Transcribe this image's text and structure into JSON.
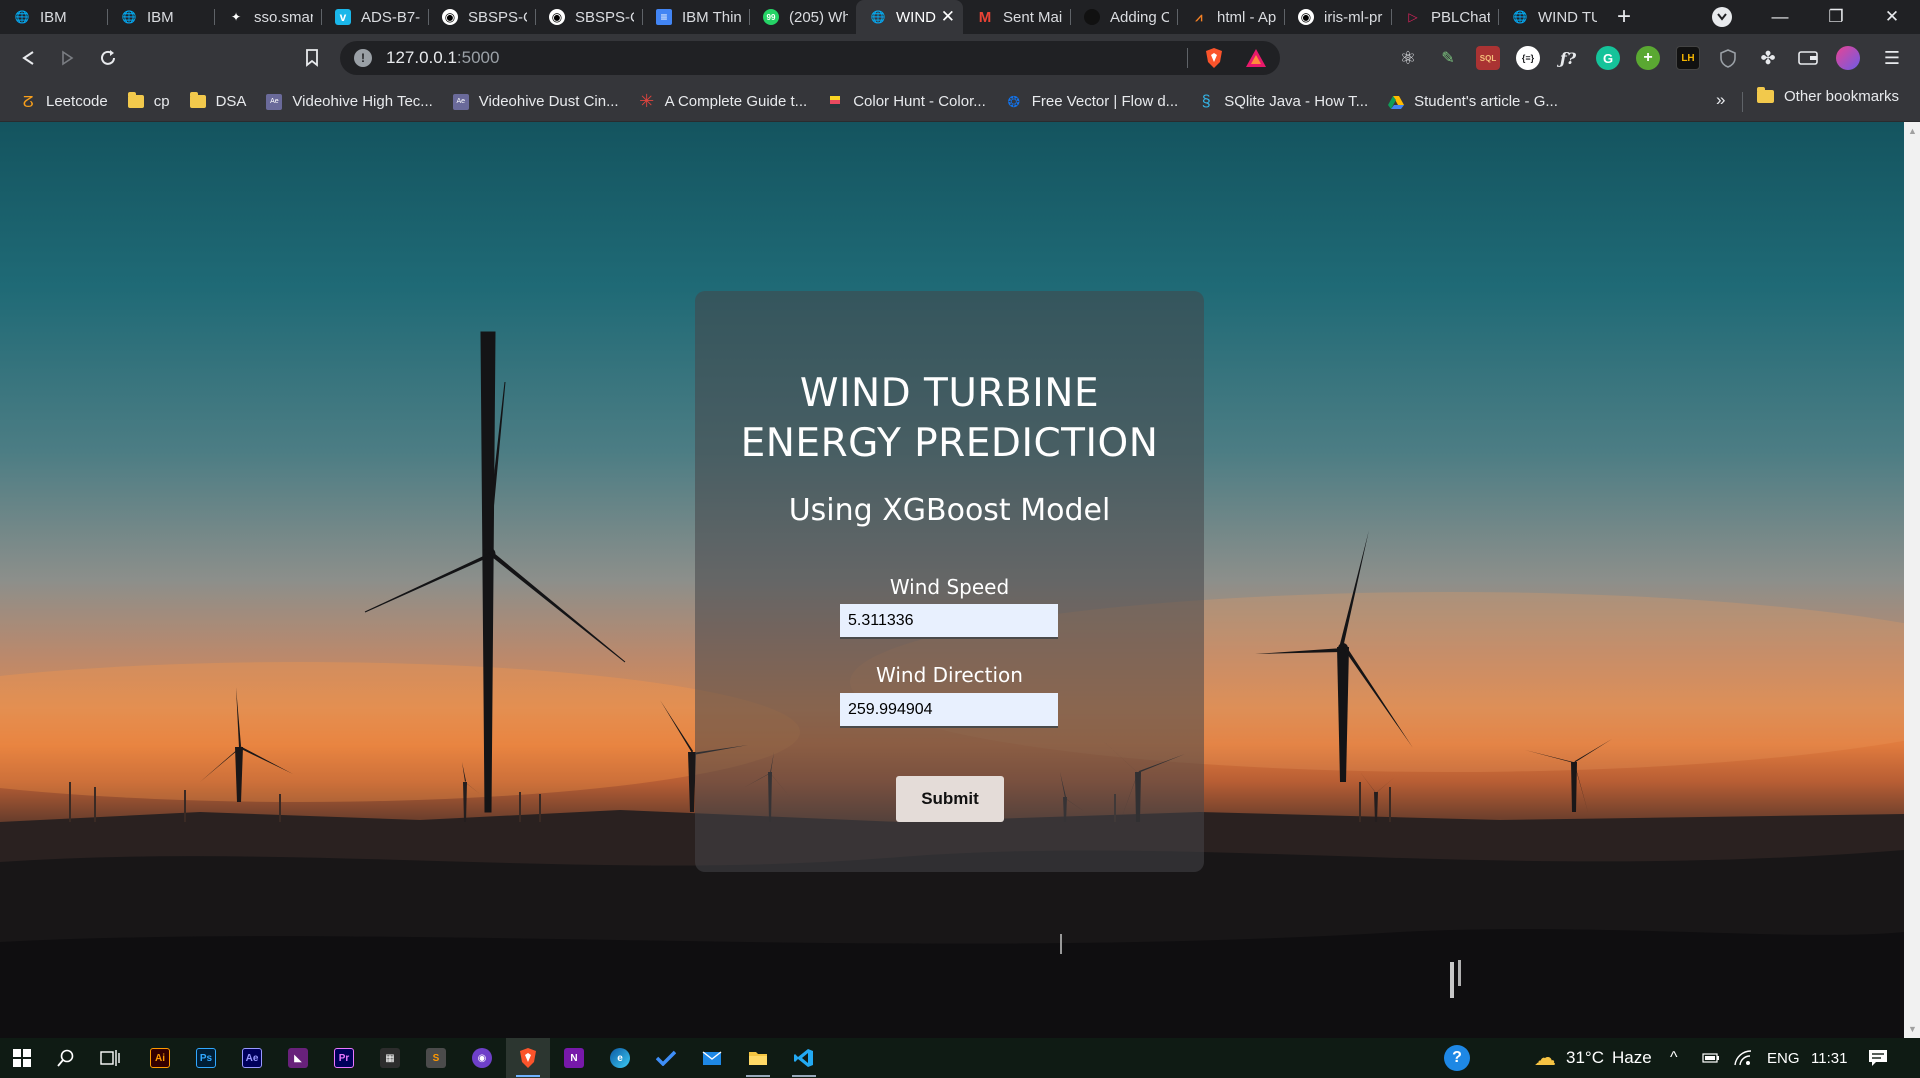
{
  "tabs": [
    {
      "title": "IBM",
      "icon": "globe-icon"
    },
    {
      "title": "IBM",
      "icon": "globe-icon"
    },
    {
      "title": "sso.smart",
      "icon": "sparkle-icon"
    },
    {
      "title": "ADS-B7-",
      "icon": "vimeo-icon"
    },
    {
      "title": "SBSPS-Cl",
      "icon": "github-icon"
    },
    {
      "title": "SBSPS-Cl",
      "icon": "github-icon"
    },
    {
      "title": "IBM Thin",
      "icon": "docs-icon"
    },
    {
      "title": "(205) Wh",
      "icon": "whatsapp-icon"
    },
    {
      "title": "WIND",
      "icon": "globe-icon",
      "active": true
    },
    {
      "title": "Sent Mai",
      "icon": "gmail-icon"
    },
    {
      "title": "Adding C",
      "icon": "circle-icon"
    },
    {
      "title": "html - Ap",
      "icon": "stackoverflow-icon"
    },
    {
      "title": "iris-ml-pr",
      "icon": "github-icon"
    },
    {
      "title": "PBLChat",
      "icon": "chat-icon"
    },
    {
      "title": "WIND TU",
      "icon": "globe-icon"
    }
  ],
  "address_bar": {
    "host": "127.0.0.1",
    "port": ":5000"
  },
  "bookmarks": [
    {
      "label": "Leetcode",
      "icon": "leetcode-icon"
    },
    {
      "label": "cp",
      "icon": "folder-icon"
    },
    {
      "label": "DSA",
      "icon": "folder-icon"
    },
    {
      "label": "Videohive High Tec...",
      "icon": "videohive-icon"
    },
    {
      "label": "Videohive Dust Cin...",
      "icon": "videohive-icon"
    },
    {
      "label": "A Complete Guide t...",
      "icon": "asterisk-icon"
    },
    {
      "label": "Color Hunt - Color...",
      "icon": "colorhunt-icon"
    },
    {
      "label": "Free Vector | Flow d...",
      "icon": "freepik-icon"
    },
    {
      "label": "SQlite Java - How T...",
      "icon": "sqlite-icon"
    },
    {
      "label": "Student's article - G...",
      "icon": "drive-icon"
    }
  ],
  "bookmarks_more": "»",
  "other_bookmarks": "Other bookmarks",
  "extensions": {
    "sql": "SQL",
    "lh": "LH",
    "formula": "ƒ?",
    "braces": "{≡}"
  },
  "form": {
    "title_line1": "WIND TURBINE",
    "title_line2": "ENERGY PREDICTION",
    "subtitle": "Using XGBoost Model",
    "wind_speed_label": "Wind Speed",
    "wind_speed_value": "5.311336",
    "wind_direction_label": "Wind Direction",
    "wind_direction_value": "259.994904",
    "submit_label": "Submit"
  },
  "taskbar": {
    "weather_temp": "31°C",
    "weather_desc": "Haze",
    "language": "ENG",
    "time": "11:31"
  },
  "colors": {
    "accent_active_tab": "#35363a",
    "taskbar": "#0f1b14",
    "input_bg": "#e8f0fe"
  }
}
